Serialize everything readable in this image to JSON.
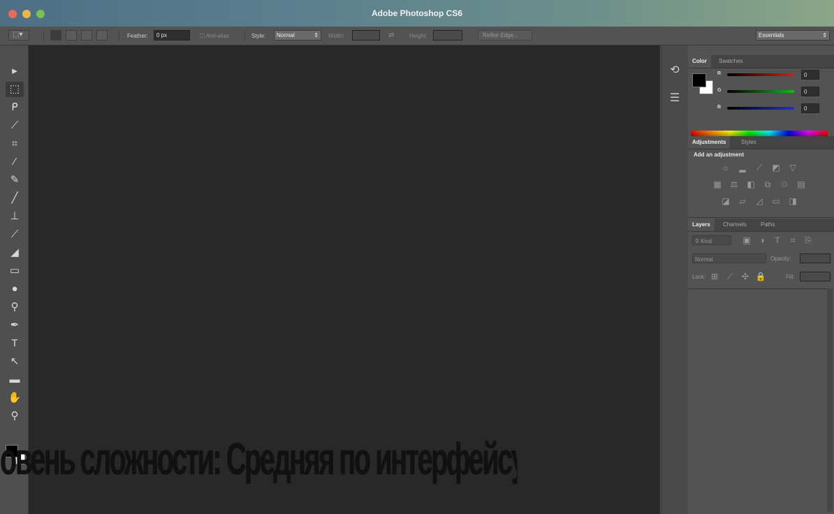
{
  "window": {
    "title": "Adobe Photoshop CS6"
  },
  "options_bar": {
    "feather_label": "Feather:",
    "feather_value": "0 px",
    "antialias_label": "Anti-alias",
    "style_label": "Style:",
    "style_value": "Normal",
    "width_label": "Width:",
    "height_label": "Height:",
    "refine_edge_label": "Refine Edge...",
    "workspace_value": "Essentials"
  },
  "tools": [
    {
      "name": "move-tool-icon",
      "glyph": "▸"
    },
    {
      "name": "marquee-tool-icon",
      "glyph": "⬚"
    },
    {
      "name": "lasso-tool-icon",
      "glyph": "ᑭ"
    },
    {
      "name": "quick-select-tool-icon",
      "glyph": "⟋"
    },
    {
      "name": "crop-tool-icon",
      "glyph": "⌗"
    },
    {
      "name": "eyedropper-tool-icon",
      "glyph": "⁄"
    },
    {
      "name": "healing-brush-tool-icon",
      "glyph": "✎"
    },
    {
      "name": "brush-tool-icon",
      "glyph": "╱"
    },
    {
      "name": "clone-stamp-tool-icon",
      "glyph": "⊥"
    },
    {
      "name": "history-brush-tool-icon",
      "glyph": "⟋"
    },
    {
      "name": "eraser-tool-icon",
      "glyph": "◢"
    },
    {
      "name": "gradient-tool-icon",
      "glyph": "▭"
    },
    {
      "name": "blur-tool-icon",
      "glyph": "●"
    },
    {
      "name": "dodge-tool-icon",
      "glyph": "⚲"
    },
    {
      "name": "pen-tool-icon",
      "glyph": "✒"
    },
    {
      "name": "type-tool-icon",
      "glyph": "T"
    },
    {
      "name": "path-select-tool-icon",
      "glyph": "↖"
    },
    {
      "name": "shape-tool-icon",
      "glyph": "▬"
    },
    {
      "name": "hand-tool-icon",
      "glyph": "✋"
    },
    {
      "name": "zoom-tool-icon",
      "glyph": "⚲"
    }
  ],
  "color_panel": {
    "tabs": [
      "Color",
      "Swatches"
    ],
    "channels": [
      {
        "label": "R",
        "value": "0",
        "color": "#d02020"
      },
      {
        "label": "G",
        "value": "0",
        "color": "#20b020"
      },
      {
        "label": "B",
        "value": "0",
        "color": "#2030d0"
      }
    ]
  },
  "adjustments_panel": {
    "tabs": [
      "Adjustments",
      "Styles"
    ],
    "heading": "Add an adjustment"
  },
  "layers_panel": {
    "tabs": [
      "Layers",
      "Channels",
      "Paths"
    ],
    "kind_label": "Kind",
    "blend_mode": "Normal",
    "opacity_label": "Opacity:",
    "lock_label": "Lock:",
    "fill_label": "Fill:"
  },
  "caption": "овень сложности: Средняя по интерфейсу, Сложная по рисованию"
}
